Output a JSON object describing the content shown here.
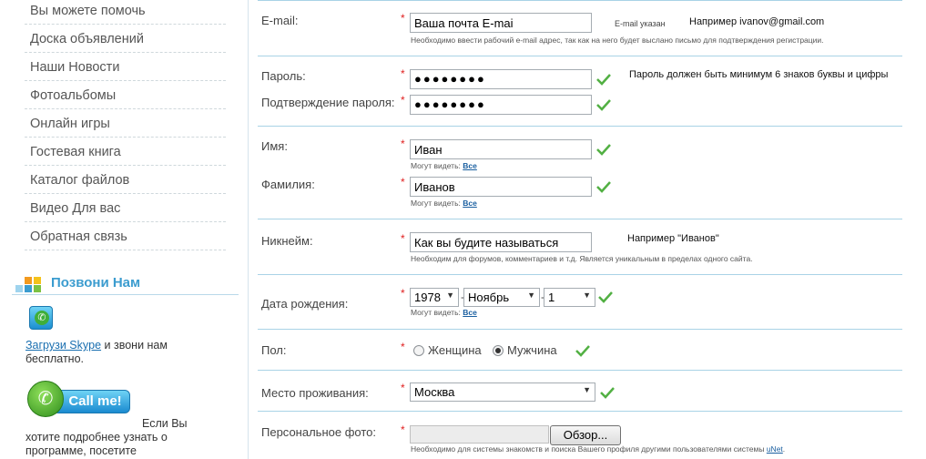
{
  "sidebar": {
    "menu": [
      "Вы можете помочь",
      "Доска объявлений",
      "Наши Новости",
      "Фотоальбомы",
      "Онлайн игры",
      "Гостевая книга",
      "Каталог файлов",
      "Видео Для вас",
      "Обратная связь"
    ],
    "call_title": "Позвони Нам",
    "skype_link": "Загрузи Skype",
    "skype_text": " и звони нам бесплатно.",
    "callme_label": "Call me!",
    "desc_line1": "Если Вы",
    "desc_rest": "хотите подробнее узнать о программе, посетите"
  },
  "form": {
    "required_mark": "*",
    "email": {
      "label": "E-mail:",
      "value": "Ваша почта  E-mai",
      "status": "E-mail указан",
      "example": "Например ivanov@gmail.com",
      "hint": "Необходимо ввести рабочий e-mail адрес, так как на него будет выслано письмо для подтверждения регистрации."
    },
    "password": {
      "label": "Пароль:",
      "value": "●●●●●●●●",
      "note": "Пароль должен быть минимум 6 знаков буквы и цифры"
    },
    "password_confirm": {
      "label": "Подтверждение пароля:",
      "value": "●●●●●●●●"
    },
    "first_name": {
      "label": "Имя:",
      "value": "Иван",
      "visible_prefix": "Могут видеть:",
      "visible_value": "Все"
    },
    "last_name": {
      "label": "Фамилия:",
      "value": "Иванов",
      "visible_prefix": "Могут видеть:",
      "visible_value": "Все"
    },
    "nickname": {
      "label": "Никнейм:",
      "value": "Как вы будите называться",
      "example": "Например  \"Иванов\"",
      "hint": "Необходим для форумов, комментариев и т.д. Является уникальным в пределах одного сайта."
    },
    "birthdate": {
      "label": "Дата рождения:",
      "year": "1978",
      "month": "Ноябрь",
      "day": "1",
      "separator": "-",
      "visible_prefix": "Могут видеть:",
      "visible_value": "Все"
    },
    "gender": {
      "label": "Пол:",
      "options": [
        "Женщина",
        "Мужчина"
      ],
      "selected": "Мужчина"
    },
    "city": {
      "label": "Место проживания:",
      "value": "Москва"
    },
    "photo": {
      "label": "Персональное фото:",
      "browse": "Обзор...",
      "hint_prefix": "Необходимо для системы знакомств и поиска Вашего профиля другими пользователями системы ",
      "hint_link": "uNet",
      "hint_suffix": "."
    }
  },
  "colors": {
    "accent": "#3b9ccf",
    "required": "#e02020",
    "separator": "#a9d3e6",
    "check": "#52b043"
  }
}
